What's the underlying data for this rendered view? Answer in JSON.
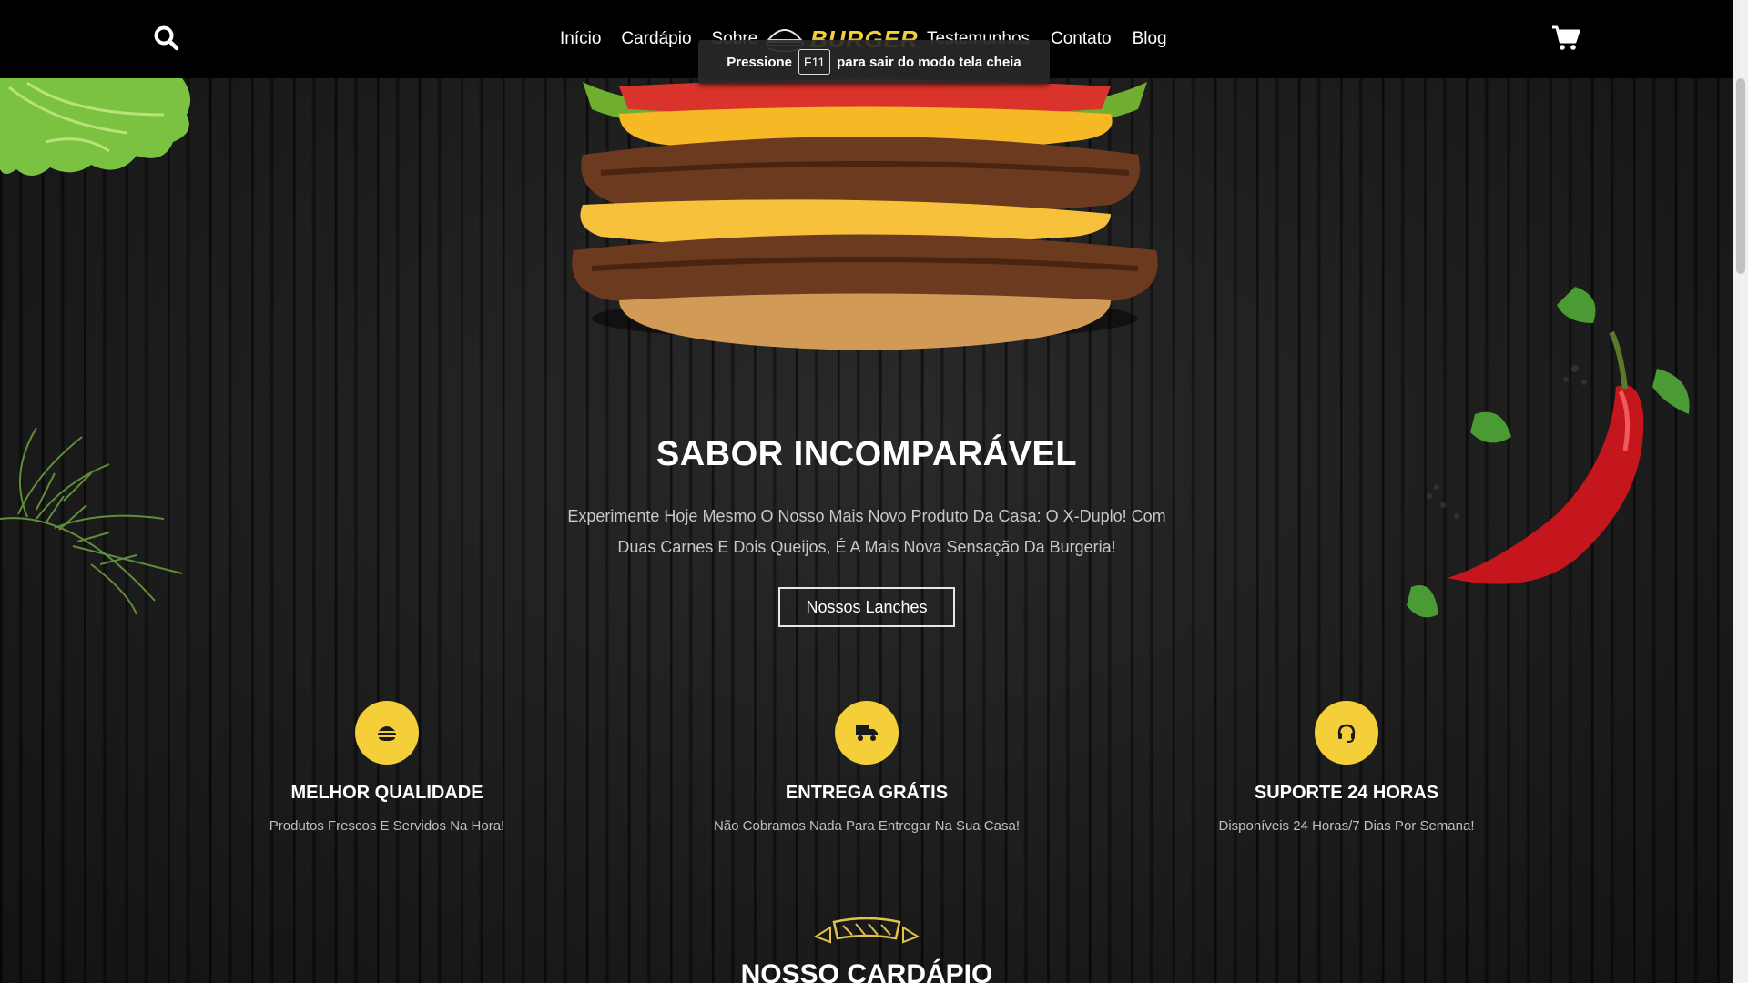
{
  "header": {
    "nav_left": [
      "Início",
      "Cardápio",
      "Sobre"
    ],
    "logo_text": "BURGER",
    "nav_right": [
      "Testemunhos",
      "Contato",
      "Blog"
    ]
  },
  "toast": {
    "before": "Pressione",
    "key": "F11",
    "after": "para sair do modo tela cheia"
  },
  "hero": {
    "title": "SABOR INCOMPARÁVEL",
    "description": "Experimente Hoje Mesmo O Nosso Mais Novo Produto Da Casa: O X-Duplo! Com Duas Carnes E Dois Queijos, É A Mais Nova Sensação Da Burgeria!",
    "button_label": "Nossos Lanches"
  },
  "features": [
    {
      "icon": "burger-icon",
      "title": "MELHOR QUALIDADE",
      "desc": "Produtos Frescos E Servidos Na Hora!"
    },
    {
      "icon": "delivery-truck-icon",
      "title": "ENTREGA GRÁTIS",
      "desc": "Não Cobramos Nada Para Entregar Na Sua Casa!"
    },
    {
      "icon": "headset-icon",
      "title": "SUPORTE 24 HORAS",
      "desc": "Disponíveis 24 Horas/7 Dias Por Semana!"
    }
  ],
  "menu_section": {
    "title": "NOSSO CARDÁPIO"
  },
  "colors": {
    "accent": "#f4cf3a",
    "header_bg": "#000000",
    "text": "#ffffff"
  }
}
